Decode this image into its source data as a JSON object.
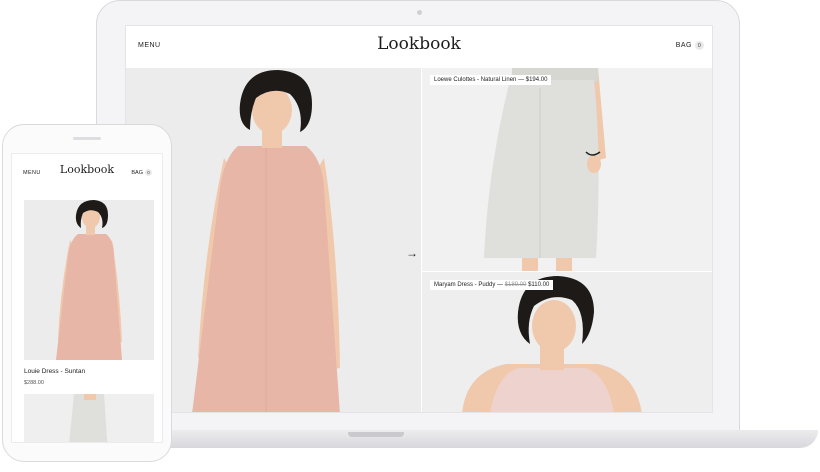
{
  "desktop": {
    "header": {
      "menu_label": "MENU",
      "logo": "Lookbook",
      "bag_label": "BAG",
      "bag_count": "0"
    },
    "products": [
      {
        "name": "Loewe Culottes - Natural Linen",
        "price": "$194.00"
      },
      {
        "name": "Maryam Dress - Puddy",
        "old_price": "$189.00",
        "price": "$110.00"
      }
    ],
    "arrow": "→"
  },
  "mobile": {
    "header": {
      "menu_label": "MENU",
      "logo": "Lookbook",
      "bag_label": "BAG",
      "bag_count": "0"
    },
    "product": {
      "name": "Louie Dress - Suntan",
      "price": "$288.00"
    }
  },
  "colors": {
    "dress_pink": "#e8b6a6",
    "linen": "#dfdfdb",
    "skin": "#f0c9ad",
    "hair": "#1e1a18",
    "top_pink": "#eed2cd"
  }
}
